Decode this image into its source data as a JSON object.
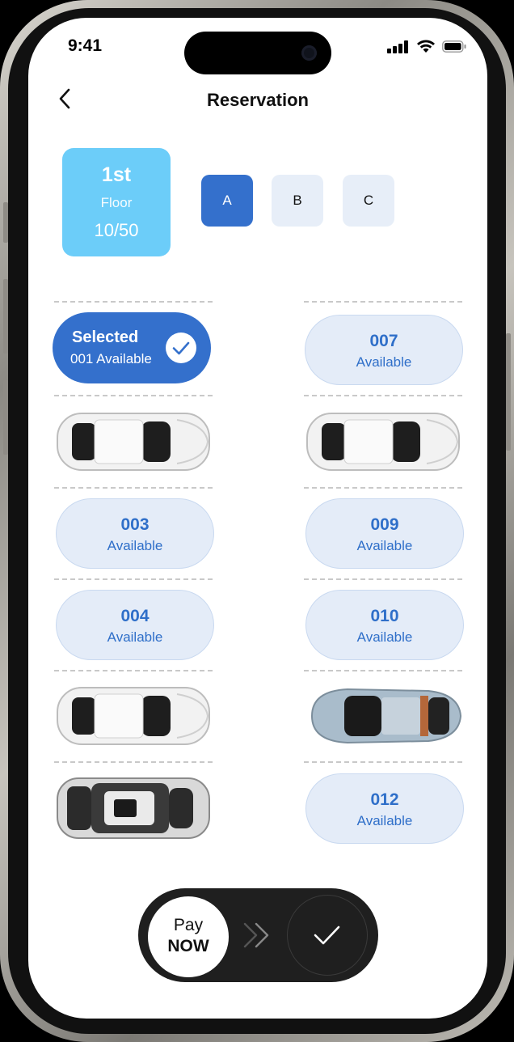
{
  "status": {
    "time": "9:41"
  },
  "header": {
    "title": "Reservation"
  },
  "floor": {
    "name": "1st",
    "label": "Floor",
    "count": "10/50"
  },
  "zones": [
    {
      "label": "A",
      "active": true
    },
    {
      "label": "B",
      "active": false
    },
    {
      "label": "C",
      "active": false
    }
  ],
  "selected_slot": {
    "title": "Selected",
    "subtitle": "001 Available"
  },
  "slots": {
    "s007": {
      "number": "007",
      "status": "Available"
    },
    "s003": {
      "number": "003",
      "status": "Available"
    },
    "s009": {
      "number": "009",
      "status": "Available"
    },
    "s004": {
      "number": "004",
      "status": "Available"
    },
    "s010": {
      "number": "010",
      "status": "Available"
    },
    "s012": {
      "number": "012",
      "status": "Available"
    }
  },
  "pay": {
    "line1": "Pay",
    "line2": "NOW"
  },
  "colors": {
    "accent": "#3470cc",
    "floor_card": "#6ccdf9",
    "slot_bg": "#e4ecf8",
    "slot_text": "#2f6fc9",
    "pay_bar": "#1f1f1f"
  }
}
